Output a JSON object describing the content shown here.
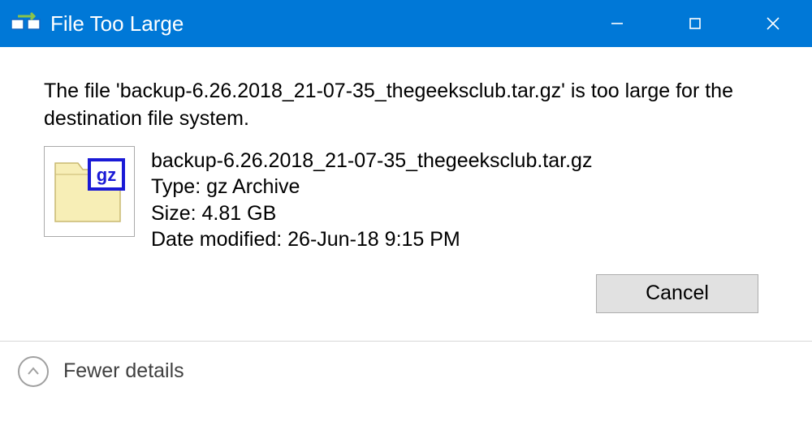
{
  "titlebar": {
    "title": "File Too Large"
  },
  "content": {
    "message": "The file 'backup-6.26.2018_21-07-35_thegeeksclub.tar.gz' is too large for the destination file system.",
    "file": {
      "name": "backup-6.26.2018_21-07-35_thegeeksclub.tar.gz",
      "type_label": "Type: gz Archive",
      "size_label": "Size: 4.81 GB",
      "date_label": "Date modified: 26-Jun-18 9:15 PM",
      "icon_badge": "gz"
    }
  },
  "buttons": {
    "cancel": "Cancel"
  },
  "details_toggle": {
    "label": "Fewer details"
  }
}
